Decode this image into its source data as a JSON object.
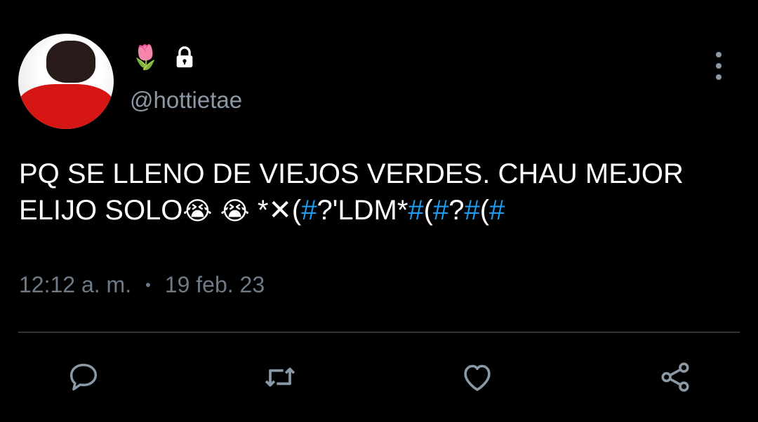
{
  "user": {
    "handle": "@hottietae",
    "name_emoji": "🌷",
    "locked_icon": "lock-icon"
  },
  "tweet": {
    "text_line1": "PQ SE LLENO DE VIEJOS VERDES. CHAU MEJOR",
    "text_line2_prefix": "ELIJO SOLO",
    "emoji": "😭",
    "text_mid": "*✕(",
    "tag1": "#",
    "text_mid2": "?'LDM*",
    "tag2": "#",
    "text_mid3": "(",
    "tag3": "#",
    "text_mid4": "?",
    "tag4": "#",
    "text_mid5": "(",
    "tag5": "#"
  },
  "meta": {
    "time": "12:12 a. m.",
    "separator": "•",
    "date": "19 feb. 23"
  },
  "actions": {
    "icons": [
      "reply-icon",
      "retweet-icon",
      "like-icon",
      "share-icon"
    ]
  },
  "colors": {
    "background": "#000000",
    "text": "#ffffff",
    "muted": "#8b98a5",
    "hashtag": "#1d9bf0",
    "divider": "#2f3336"
  }
}
